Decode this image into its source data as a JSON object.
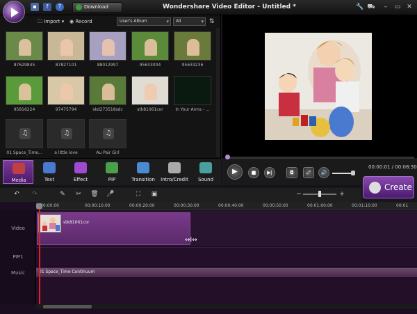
{
  "titlebar": {
    "download_label": "Download",
    "title": "Wondershare Video Editor - Untitled *"
  },
  "library": {
    "import_label": "Import",
    "record_label": "Record",
    "album_select": "User's Album",
    "filter_select": "All",
    "items": [
      {
        "caption": "87629845",
        "kind": "photo",
        "color": "#6a8a4a"
      },
      {
        "caption": "87827101",
        "kind": "photo",
        "color": "#c8b898"
      },
      {
        "caption": "88012997",
        "kind": "photo",
        "color": "#a8a0c0"
      },
      {
        "caption": "95633004",
        "kind": "photo",
        "color": "#5a8a3a"
      },
      {
        "caption": "95633236",
        "kind": "photo",
        "color": "#6a7a3a"
      },
      {
        "caption": "95816224",
        "kind": "photo",
        "color": "#5a9a3a"
      },
      {
        "caption": "97475794",
        "kind": "photo",
        "color": "#d8c8a8"
      },
      {
        "caption": "skd273518sdc",
        "kind": "photo",
        "color": "#5a7a3a"
      },
      {
        "caption": "stk81061cor",
        "kind": "photo",
        "color": "#e0dcd4"
      },
      {
        "caption": "In Your Arms - ...",
        "kind": "music-video",
        "color": "#0a1a10"
      },
      {
        "caption": "01 Space_Time...",
        "kind": "audio",
        "color": "#2a2a2a"
      },
      {
        "caption": "a little love",
        "kind": "audio",
        "color": "#2a2a2a"
      },
      {
        "caption": "Au Pair Girl",
        "kind": "audio",
        "color": "#2a2a2a"
      }
    ]
  },
  "tabs": [
    {
      "label": "Media",
      "icon": "media-icon",
      "color": "#c04040",
      "active": true
    },
    {
      "label": "Text",
      "icon": "text-icon",
      "color": "#4a7ad0"
    },
    {
      "label": "Effect",
      "icon": "effect-icon",
      "color": "#a04ad0"
    },
    {
      "label": "PIP",
      "icon": "pip-icon",
      "color": "#4aa04a"
    },
    {
      "label": "Transition",
      "icon": "transition-icon",
      "color": "#4a8ad0"
    },
    {
      "label": "Intro/Credit",
      "icon": "intro-credit-icon",
      "color": "#aaaaaa"
    },
    {
      "label": "Sound",
      "icon": "sound-icon",
      "color": "#4aa0a0"
    }
  ],
  "player": {
    "timecode": "00:00:01 / 00:08:30"
  },
  "create_label": "Create",
  "timeline": {
    "ruler_ticks": [
      "00:00:00",
      "00:00:10:00",
      "00:00:20:00",
      "00:00:30:00",
      "00:00:40:00",
      "00:00:50:00",
      "00:01:00:00",
      "00:01:10:00",
      "00:01"
    ],
    "tracks": {
      "video": "Video",
      "pip": "PIP1",
      "music": "Music"
    },
    "video_clip_label": "stk81061cor",
    "music_clip_label": "01 Space_Time Continuum"
  },
  "colors": {
    "accent": "#7a3a9a",
    "clip": "#7a3a8a",
    "playhead": "#e02020"
  }
}
